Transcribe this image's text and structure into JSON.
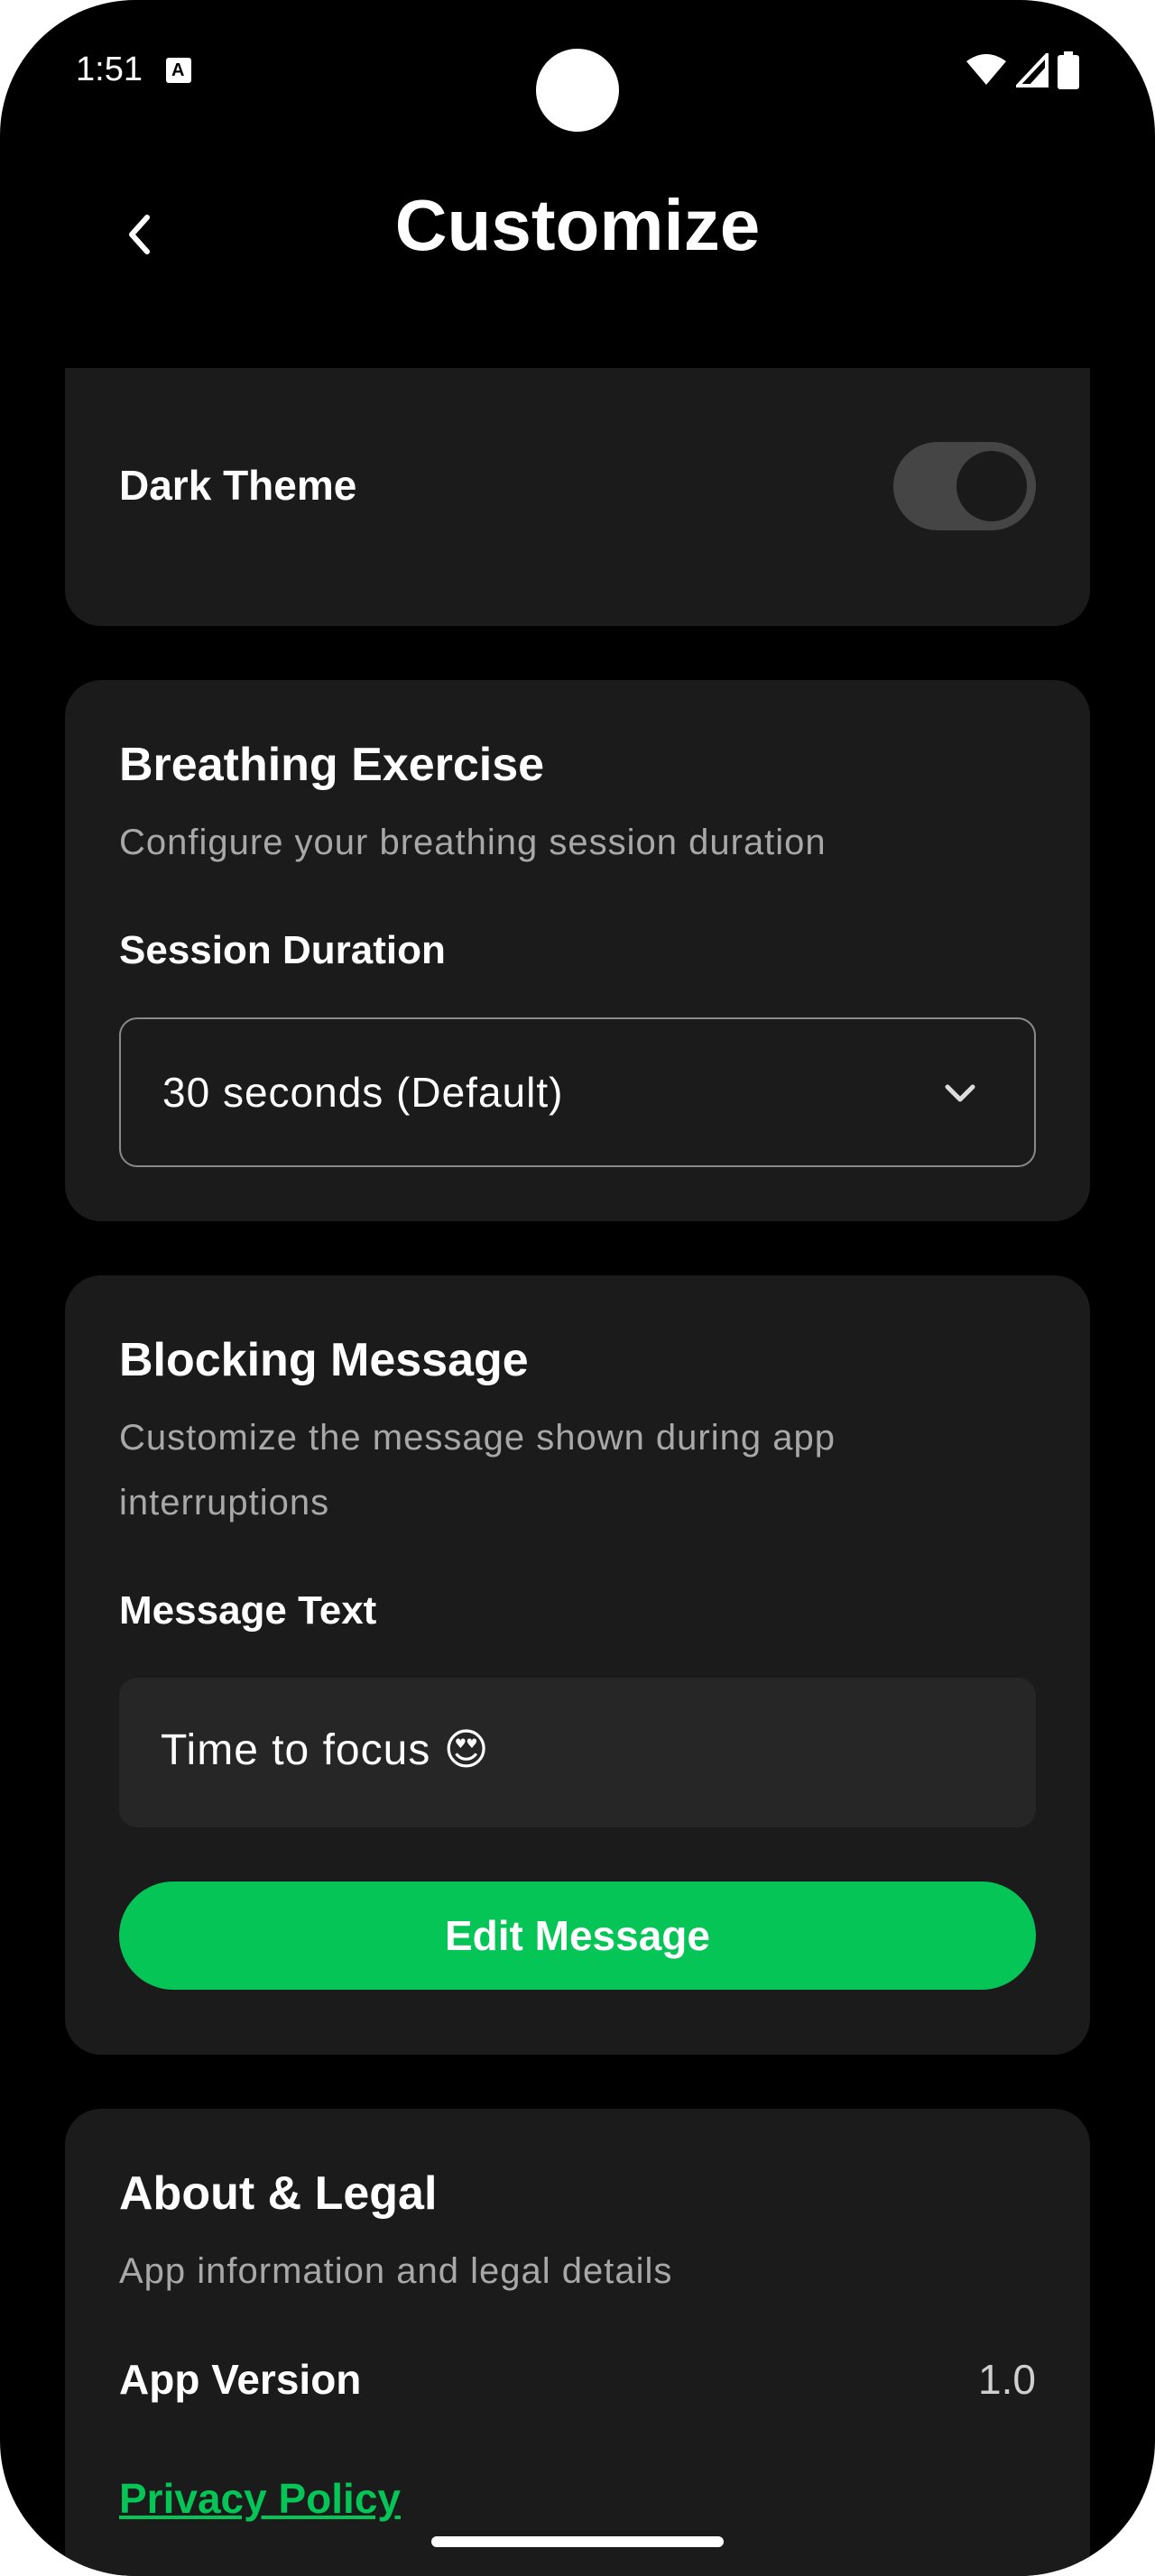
{
  "status_bar": {
    "time": "1:51",
    "icons": [
      "notification-a-icon",
      "wifi-icon",
      "signal-icon",
      "battery-icon"
    ]
  },
  "header": {
    "title": "Customize",
    "back_icon": "chevron-left-icon"
  },
  "appearance": {
    "dark_theme_label": "Dark Theme",
    "dark_theme_enabled": true
  },
  "breathing": {
    "title": "Breathing Exercise",
    "description": "Configure your breathing session duration",
    "field_label": "Session Duration",
    "selected_duration": "30 seconds (Default)"
  },
  "blocking": {
    "title": "Blocking Message",
    "description": "Customize the message shown during app interruptions",
    "field_label": "Message Text",
    "message": "Time to focus 😍",
    "button_label": "Edit Message"
  },
  "about": {
    "title": "About & Legal",
    "description": "App information and legal details",
    "version_label": "App Version",
    "version_value": "1.0",
    "privacy_link": "Privacy Policy"
  },
  "colors": {
    "background": "#000000",
    "card": "#1b1b1b",
    "accent": "#05c556",
    "text_primary": "#ffffff",
    "text_secondary": "#a8a8a8"
  }
}
